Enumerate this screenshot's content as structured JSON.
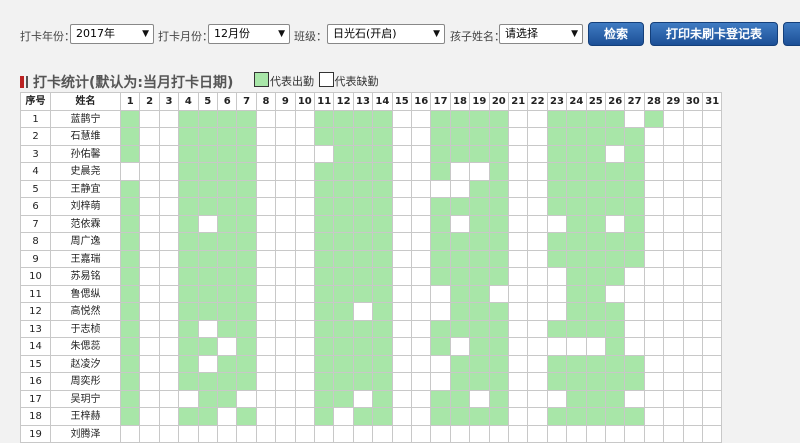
{
  "filters": {
    "year_label": "打卡年份：",
    "year_value": "2017年",
    "month_label": "打卡月份：",
    "month_value": "12月份",
    "class_label": "班级：",
    "class_value": "日光石(开启)",
    "child_label": "孩子姓名：",
    "child_value": "请选择"
  },
  "buttons": {
    "search": "检索",
    "print_unswiped": "打印未刷卡登记表"
  },
  "section": {
    "title": "打卡统计(默认为:当月打卡日期)"
  },
  "legend": {
    "present": "代表出勤",
    "absent": "代表缺勤"
  },
  "colors": {
    "present": "#a8e6a8",
    "absent": "#ffffff",
    "button": "#1c4f96"
  },
  "table": {
    "header_index": "序号",
    "header_name": "姓名",
    "days": [
      "1",
      "2",
      "3",
      "4",
      "5",
      "6",
      "7",
      "8",
      "9",
      "10",
      "11",
      "12",
      "13",
      "14",
      "15",
      "16",
      "17",
      "18",
      "19",
      "20",
      "21",
      "22",
      "23",
      "24",
      "25",
      "26",
      "27",
      "28",
      "29",
      "30",
      "31"
    ],
    "rows": [
      {
        "no": "1",
        "name": "蓝鹊宁",
        "att": "1001111000111100111100111101000"
      },
      {
        "no": "2",
        "name": "石慧维",
        "att": "1001111000111100111100111110000"
      },
      {
        "no": "3",
        "name": "孙佑馨",
        "att": "1001111000011100111100111010000"
      },
      {
        "no": "4",
        "name": "史晨尧",
        "att": "0001111000111100100100111110000"
      },
      {
        "no": "5",
        "name": "王静宜",
        "att": "1001111000111100001100111110000"
      },
      {
        "no": "6",
        "name": "刘梓萌",
        "att": "1001111000111100111100111110000"
      },
      {
        "no": "7",
        "name": "范依霖",
        "att": "1001011000111100101100011010000"
      },
      {
        "no": "8",
        "name": "周广逸",
        "att": "1001111000111100111100111110000"
      },
      {
        "no": "9",
        "name": "王嘉瑞",
        "att": "1001111000111100111100111110000"
      },
      {
        "no": "10",
        "name": "苏易铭",
        "att": "1001111000111100111100011100000"
      },
      {
        "no": "11",
        "name": "鲁偲纵",
        "att": "1001111000111100011000011000000"
      },
      {
        "no": "12",
        "name": "高悦然",
        "att": "1001111000110100011100011100000"
      },
      {
        "no": "13",
        "name": "于志桢",
        "att": "1001011000111100111100111100000"
      },
      {
        "no": "14",
        "name": "朱偲蕊",
        "att": "1001101000111100101100000100000"
      },
      {
        "no": "15",
        "name": "赵凌汐",
        "att": "1001011000111100011100111110000"
      },
      {
        "no": "16",
        "name": "周奕彤",
        "att": "1001111000111100011100111110000"
      },
      {
        "no": "17",
        "name": "吴玥宁",
        "att": "1000110000110100110100011100000"
      },
      {
        "no": "18",
        "name": "王梓赫",
        "att": "1001101000101100111100111110000"
      },
      {
        "no": "19",
        "name": "刘腾泽",
        "att": "0000000000000000000000000000000"
      }
    ]
  }
}
